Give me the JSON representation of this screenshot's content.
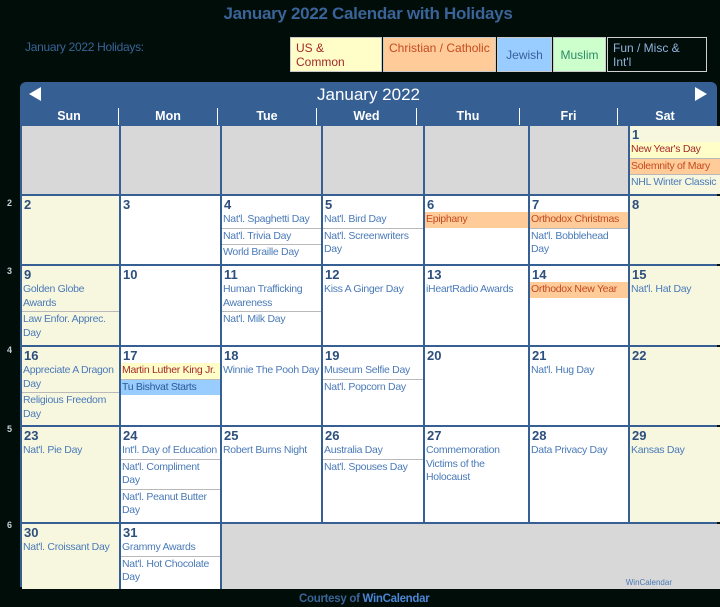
{
  "title": "January 2022 Calendar with Holidays",
  "holidays_label": "January 2022 Holidays:",
  "legend": {
    "us": "US & Common",
    "christian": "Christian / Catholic",
    "jewish": "Jewish",
    "muslim": "Muslim",
    "fun": "Fun / Misc & Int'l"
  },
  "calendar": {
    "month_title": "January 2022",
    "prev_icon": "triangle-left",
    "next_icon": "triangle-right",
    "weekdays": [
      "Sun",
      "Mon",
      "Tue",
      "Wed",
      "Thu",
      "Fri",
      "Sat"
    ],
    "week_numbers": [
      "2",
      "3",
      "4",
      "5",
      "6"
    ],
    "days": {
      "1": {
        "num": "1",
        "events": [
          {
            "t": "New Year's Day",
            "c": "us"
          },
          {
            "t": "Solemnity of Mary",
            "c": "ch"
          },
          {
            "t": "NHL Winter Classic",
            "c": "fun"
          }
        ]
      },
      "2": {
        "num": "2",
        "events": []
      },
      "3": {
        "num": "3",
        "events": []
      },
      "4": {
        "num": "4",
        "events": [
          {
            "t": "Nat'l. Spaghetti Day",
            "c": "fun"
          },
          {
            "t": "Nat'l. Trivia Day",
            "c": "fun"
          },
          {
            "t": "World Braille Day",
            "c": "fun"
          }
        ]
      },
      "5": {
        "num": "5",
        "events": [
          {
            "t": "Nat'l. Bird Day",
            "c": "fun"
          },
          {
            "t": "Nat'l. Screenwriters Day",
            "c": "fun"
          }
        ]
      },
      "6": {
        "num": "6",
        "events": [
          {
            "t": "Epiphany",
            "c": "ch"
          }
        ]
      },
      "7": {
        "num": "7",
        "events": [
          {
            "t": "Orthodox Christmas",
            "c": "ch"
          },
          {
            "t": "Nat'l. Bobblehead Day",
            "c": "fun"
          }
        ]
      },
      "8": {
        "num": "8",
        "events": []
      },
      "9": {
        "num": "9",
        "events": [
          {
            "t": "Golden Globe Awards",
            "c": "fun"
          },
          {
            "t": "Law Enfor. Apprec. Day",
            "c": "fun"
          }
        ]
      },
      "10": {
        "num": "10",
        "events": []
      },
      "11": {
        "num": "11",
        "events": [
          {
            "t": "Human Trafficking Awareness",
            "c": "fun"
          },
          {
            "t": "Nat'l. Milk Day",
            "c": "fun"
          }
        ]
      },
      "12": {
        "num": "12",
        "events": [
          {
            "t": "Kiss A Ginger Day",
            "c": "fun"
          }
        ]
      },
      "13": {
        "num": "13",
        "events": [
          {
            "t": "iHeartRadio Awards",
            "c": "fun"
          }
        ]
      },
      "14": {
        "num": "14",
        "events": [
          {
            "t": "Orthodox New Year",
            "c": "ch"
          }
        ]
      },
      "15": {
        "num": "15",
        "events": [
          {
            "t": "Nat'l. Hat Day",
            "c": "fun"
          }
        ]
      },
      "16": {
        "num": "16",
        "events": [
          {
            "t": "Appreciate A Dragon Day",
            "c": "fun"
          },
          {
            "t": "Religious Freedom Day",
            "c": "fun"
          }
        ]
      },
      "17": {
        "num": "17",
        "events": [
          {
            "t": "Martin Luther King Jr.",
            "c": "us"
          },
          {
            "t": "Tu Bishvat Starts",
            "c": "jw"
          }
        ]
      },
      "18": {
        "num": "18",
        "events": [
          {
            "t": "Winnie The Pooh Day",
            "c": "fun"
          }
        ]
      },
      "19": {
        "num": "19",
        "events": [
          {
            "t": "Museum Selfie Day",
            "c": "fun"
          },
          {
            "t": "Nat'l. Popcorn Day",
            "c": "fun"
          }
        ]
      },
      "20": {
        "num": "20",
        "events": []
      },
      "21": {
        "num": "21",
        "events": [
          {
            "t": "Nat'l. Hug Day",
            "c": "fun"
          }
        ]
      },
      "22": {
        "num": "22",
        "events": []
      },
      "23": {
        "num": "23",
        "events": [
          {
            "t": "Nat'l. Pie Day",
            "c": "fun"
          }
        ]
      },
      "24": {
        "num": "24",
        "events": [
          {
            "t": "Int'l. Day of Education",
            "c": "fun"
          },
          {
            "t": "Nat'l. Compliment Day",
            "c": "fun"
          },
          {
            "t": "Nat'l. Peanut Butter Day",
            "c": "fun"
          }
        ]
      },
      "25": {
        "num": "25",
        "events": [
          {
            "t": "Robert Burns Night",
            "c": "fun"
          }
        ]
      },
      "26": {
        "num": "26",
        "events": [
          {
            "t": "Australia Day",
            "c": "fun"
          },
          {
            "t": "Nat'l. Spouses Day",
            "c": "fun"
          }
        ]
      },
      "27": {
        "num": "27",
        "events": [
          {
            "t": "Commemoration Victims of the Holocaust",
            "c": "fun"
          }
        ]
      },
      "28": {
        "num": "28",
        "events": [
          {
            "t": "Data Privacy Day",
            "c": "fun"
          }
        ]
      },
      "29": {
        "num": "29",
        "events": [
          {
            "t": "Kansas Day",
            "c": "fun"
          }
        ]
      },
      "30": {
        "num": "30",
        "events": [
          {
            "t": "Nat'l. Croissant Day",
            "c": "fun"
          }
        ]
      },
      "31": {
        "num": "31",
        "events": [
          {
            "t": "Grammy Awards",
            "c": "fun"
          },
          {
            "t": "Nat'l. Hot Chocolate Day",
            "c": "fun"
          }
        ]
      }
    },
    "brand": "WinCalendar"
  },
  "footer": {
    "courtesy_prefix": "Courtesy of",
    "courtesy_link": "WinCalendar"
  },
  "colors": {
    "header_blue": "#366094",
    "us": "#fffdc8",
    "christian": "#ffcc99",
    "jewish": "#99ccff",
    "muslim": "#ccffcc",
    "weekend": "#f7f7e0",
    "empty": "#d8d8d8"
  }
}
